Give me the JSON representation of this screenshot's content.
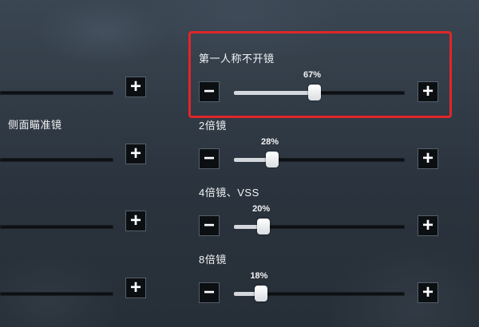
{
  "left_column": {
    "side_scope_label": "侧面瞄准镜"
  },
  "right_column": {
    "settings": [
      {
        "id": "first-person-no-scope",
        "label": "第一人称不开镜",
        "value_text": "67%",
        "value": 67
      },
      {
        "id": "scope-2x",
        "label": "2倍镜",
        "value_text": "28%",
        "value": 28
      },
      {
        "id": "scope-4x",
        "label": "4倍镜、VSS",
        "value_text": "20%",
        "value": 20
      },
      {
        "id": "scope-8x",
        "label": "8倍镜",
        "value_text": "18%",
        "value": 18
      }
    ]
  },
  "buttons": {
    "minus_glyph": "−",
    "plus_glyph": "+"
  },
  "colors": {
    "highlight_box": "#e0262a",
    "track": "#0d1013",
    "track_fill": "#d4d8dc",
    "thumb": "#ffffff",
    "button_bg": "#0c0f12"
  },
  "icons": {
    "minus": "minus-icon",
    "plus": "plus-icon"
  }
}
